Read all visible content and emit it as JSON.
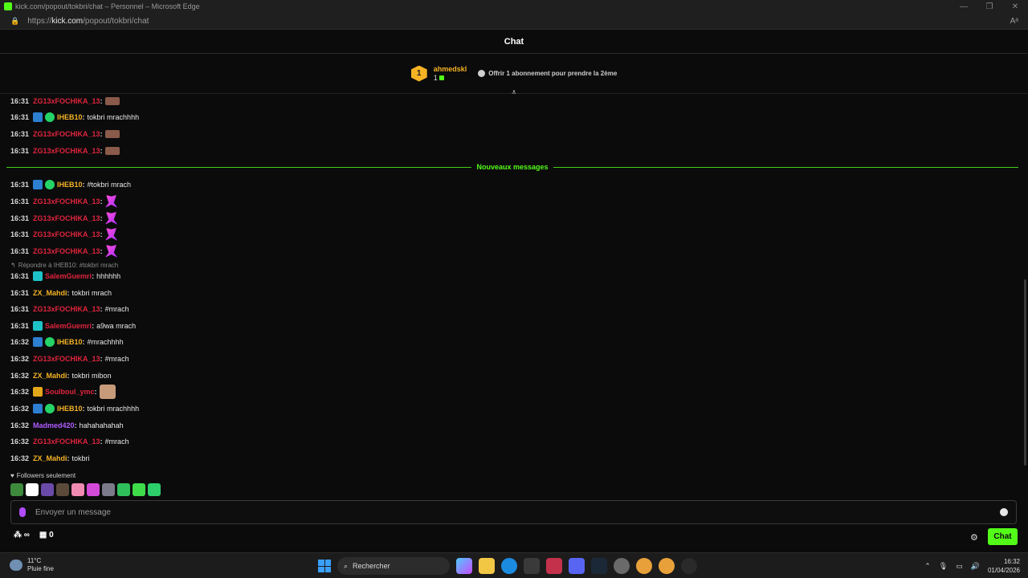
{
  "browser": {
    "window_title": "kick.com/popout/tokbri/chat – Personnel – Microsoft Edge",
    "url_prefix": "https://",
    "url_domain": "kick.com",
    "url_path": "/popout/tokbri/chat"
  },
  "chat": {
    "header_title": "Chat",
    "pinned": {
      "rank": "1",
      "username": "ahmedskl",
      "count": "1",
      "offer_text": "Offrir 1 abonnement pour prendre la 2ème"
    },
    "new_messages_label": "Nouveaux messages",
    "reply_text": "Répondre à IHEB10: #tokbri mrach",
    "messages": [
      {
        "time": "16:31",
        "user": "ZG13xFOCHIKA_13",
        "text": ""
      },
      {
        "time": "16:31",
        "user": "IHEB10",
        "text": "tokbri mrachhhh"
      },
      {
        "time": "16:31",
        "user": "ZG13xFOCHIKA_13",
        "text": ""
      },
      {
        "time": "16:31",
        "user": "ZG13xFOCHIKA_13",
        "text": ""
      },
      {
        "time": "16:31",
        "user": "IHEB10",
        "text": "#tokbri mrach"
      },
      {
        "time": "16:31",
        "user": "ZG13xFOCHIKA_13",
        "text": ""
      },
      {
        "time": "16:31",
        "user": "ZG13xFOCHIKA_13",
        "text": ""
      },
      {
        "time": "16:31",
        "user": "ZG13xFOCHIKA_13",
        "text": ""
      },
      {
        "time": "16:31",
        "user": "ZG13xFOCHIKA_13",
        "text": ""
      },
      {
        "time": "16:31",
        "user": "SalemGuemri",
        "text": "hhhhhh"
      },
      {
        "time": "16:31",
        "user": "ZX_Mahdi",
        "text": "tokbri mrach"
      },
      {
        "time": "16:31",
        "user": "ZG13xFOCHIKA_13",
        "text": "#mrach"
      },
      {
        "time": "16:31",
        "user": "SalemGuemri",
        "text": "a9wa mrach"
      },
      {
        "time": "16:32",
        "user": "IHEB10",
        "text": "#mrachhhh"
      },
      {
        "time": "16:32",
        "user": "ZG13xFOCHIKA_13",
        "text": "#mrach"
      },
      {
        "time": "16:32",
        "user": "ZX_Mahdi",
        "text": "tokbri mibon"
      },
      {
        "time": "16:32",
        "user": "Soulboul_ymc",
        "text": ""
      },
      {
        "time": "16:32",
        "user": "IHEB10",
        "text": "tokbri mrachhhh"
      },
      {
        "time": "16:32",
        "user": "Madmed420",
        "text": "hahahahahah"
      },
      {
        "time": "16:32",
        "user": "ZG13xFOCHIKA_13",
        "text": "#mrach"
      },
      {
        "time": "16:32",
        "user": "ZX_Mahdi",
        "text": "tokbri"
      }
    ],
    "followers_only_label": "Followers seulement",
    "input_placeholder": "Envoyer un message",
    "bottom": {
      "infinity": "∞",
      "points": "0",
      "chat_button": "Chat"
    }
  },
  "taskbar": {
    "weather_temp": "11°C",
    "weather_desc": "Pluie fine",
    "search_label": "Rechercher",
    "time": "16:32",
    "date": "01/04/2026"
  },
  "colors": {
    "accent_green": "#53fc18",
    "user_red": "#e0243c",
    "user_gold": "#f5b324",
    "user_purple": "#b05cff"
  }
}
